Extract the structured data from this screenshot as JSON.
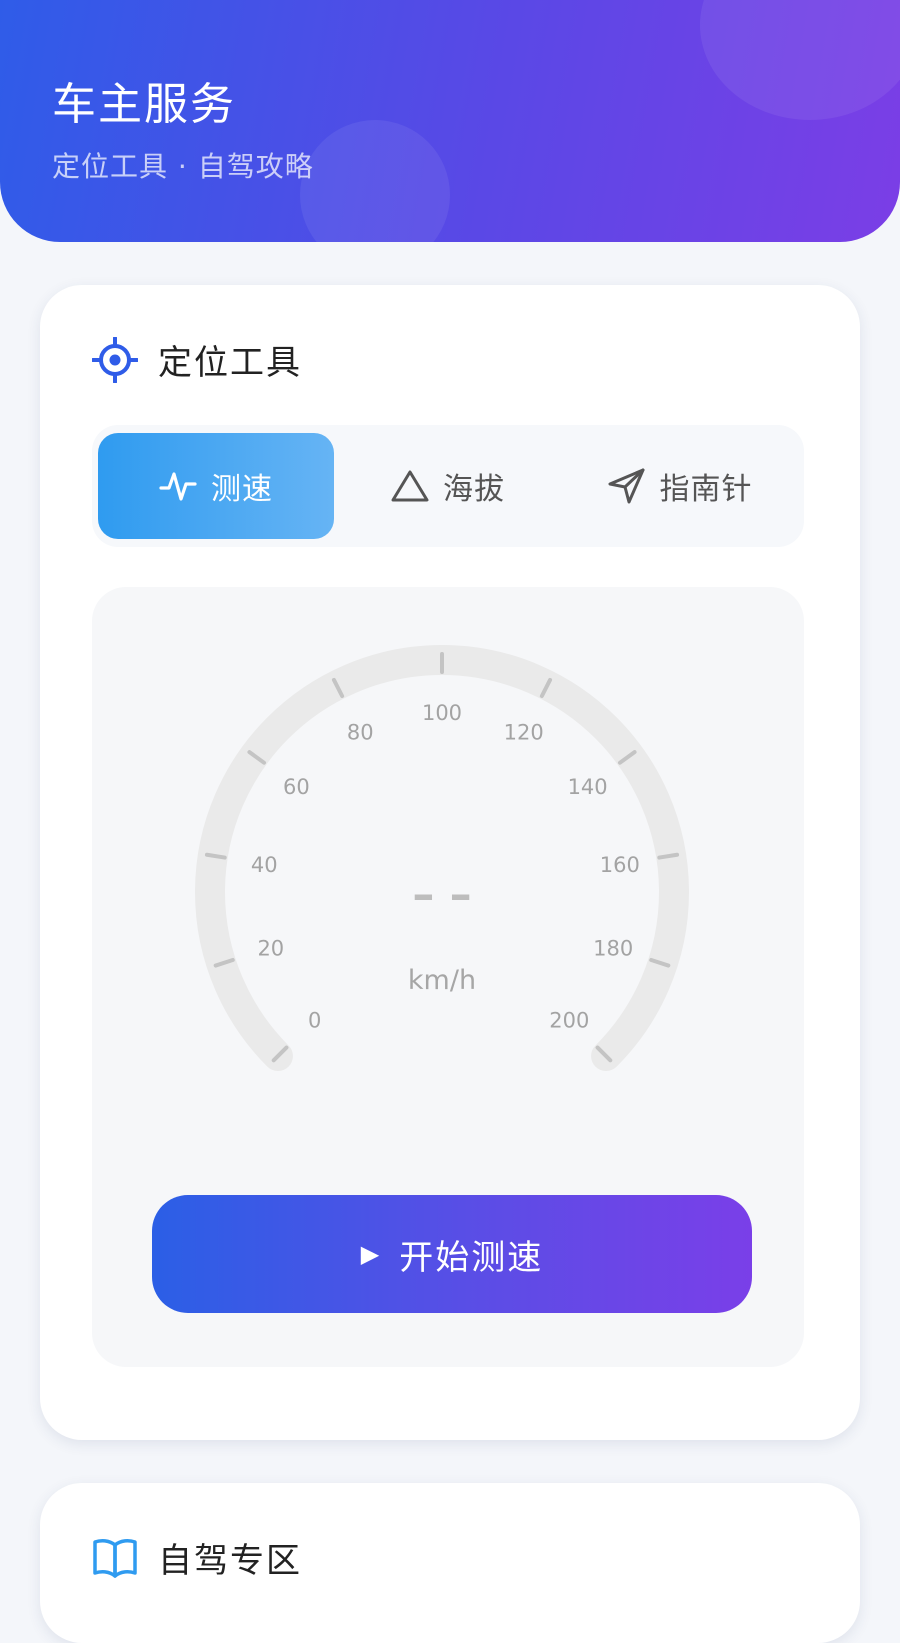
{
  "header": {
    "title": "车主服务",
    "subtitle": "定位工具 · 自驾攻略"
  },
  "tools_card": {
    "title": "定位工具",
    "icon": "target-icon",
    "tabs": [
      {
        "label": "测速",
        "icon": "pulse-icon",
        "active": true
      },
      {
        "label": "海拔",
        "icon": "triangle-icon",
        "active": false
      },
      {
        "label": "指南针",
        "icon": "navigation-arrow-icon",
        "active": false
      }
    ],
    "speedometer": {
      "min": 0,
      "max": 200,
      "tick_labels": [
        "0",
        "20",
        "40",
        "60",
        "80",
        "100",
        "120",
        "140",
        "160",
        "180",
        "200"
      ],
      "value_display": "– –",
      "unit": "km/h"
    },
    "start_button_label": "开始测速",
    "start_button_icon": "play-icon"
  },
  "drive_card": {
    "title": "自驾专区",
    "icon": "open-book-icon"
  },
  "colors": {
    "accent_blue": "#2f5ce8",
    "accent_purple": "#7b3ee6",
    "tab_active": "#2f9bf0",
    "gauge_track": "#eaeaea"
  }
}
